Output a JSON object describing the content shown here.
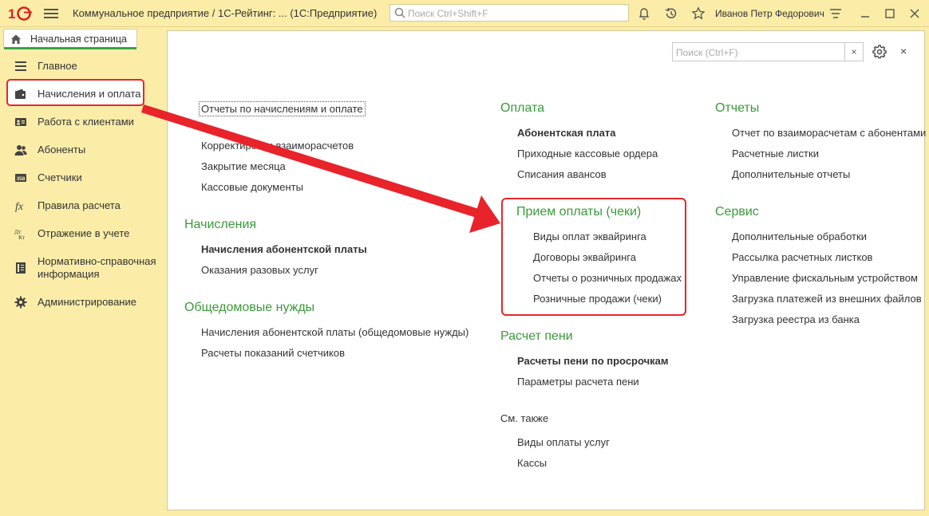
{
  "header": {
    "app_title": "Коммунальное предприятие / 1С-Рейтинг: ...  (1С:Предприятие)",
    "search_placeholder": "Поиск Ctrl+Shift+F",
    "user_name": "Иванов Петр Федорович",
    "icons": [
      "1c-logo-icon",
      "hamburger-menu-icon",
      "search-icon",
      "bell-icon",
      "history-icon",
      "star-icon",
      "settings-lines-icon",
      "minimize-icon",
      "maximize-icon",
      "close-icon"
    ]
  },
  "tabs": {
    "home_label": "Начальная страница"
  },
  "sidebar": {
    "items": [
      {
        "label": "Главное",
        "icon": "list-icon"
      },
      {
        "label": "Начисления и оплата",
        "icon": "wallet-icon",
        "active": true
      },
      {
        "label": "Работа с клиентами",
        "icon": "contacts-icon"
      },
      {
        "label": "Абоненты",
        "icon": "users-icon"
      },
      {
        "label": "Счетчики",
        "icon": "meter-icon"
      },
      {
        "label": "Правила расчета",
        "icon": "fx-icon"
      },
      {
        "label": "Отражение в учете",
        "icon": "dt-kt-icon"
      },
      {
        "label": "Нормативно-справочная\nинформация",
        "label_line1": "Нормативно-справочная",
        "label_line2": "информация",
        "icon": "book-icon"
      },
      {
        "label": "Администрирование",
        "icon": "gear-icon"
      }
    ],
    "accent_color": "#e3282b"
  },
  "main": {
    "search_placeholder": "Поиск (Ctrl+F)",
    "clear_label": "×",
    "close_label": "×",
    "col1": {
      "top_links": [
        "Отчеты по начислениям и оплате",
        "Корректировки взаиморасчетов",
        "Закрытие месяца",
        "Кассовые документы"
      ],
      "sections": [
        {
          "title": "Начисления",
          "links": [
            "Начисления абонентской платы",
            "Оказания разовых услуг"
          ]
        },
        {
          "title": "Общедомовые нужды",
          "links": [
            "Начисления абонентской платы (общедомовые нужды)",
            "Расчеты показаний счетчиков"
          ]
        }
      ]
    },
    "col2": {
      "sections": [
        {
          "title": "Оплата",
          "links": [
            "Абонентская плата",
            "Приходные кассовые ордера",
            "Списания авансов"
          ]
        },
        {
          "title": "Прием оплаты (чеки)",
          "links": [
            "Виды оплат эквайринга",
            "Договоры эквайринга",
            "Отчеты о розничных продажах",
            "Розничные продажи (чеки)"
          ]
        },
        {
          "title": "Расчет пени",
          "links": [
            "Расчеты пени по просрочкам",
            "Параметры расчета пени"
          ]
        }
      ],
      "see_also": {
        "title": "См. также",
        "links": [
          "Виды оплаты услуг",
          "Кассы"
        ]
      }
    },
    "col3": {
      "sections": [
        {
          "title": "Отчеты",
          "links": [
            "Отчет по взаиморасчетам с абонентами",
            "Расчетные листки",
            "Дополнительные отчеты"
          ]
        },
        {
          "title": "Сервис",
          "links": [
            "Дополнительные обработки",
            "Рассылка расчетных листков",
            "Управление фискальным устройством",
            "Загрузка платежей из внешних файлов",
            "Загрузка реестра из банка"
          ]
        }
      ]
    }
  },
  "colors": {
    "section_heading": "#3a9a3a",
    "panel_bg": "#fbeda8",
    "annotation_red": "#e3282b"
  }
}
